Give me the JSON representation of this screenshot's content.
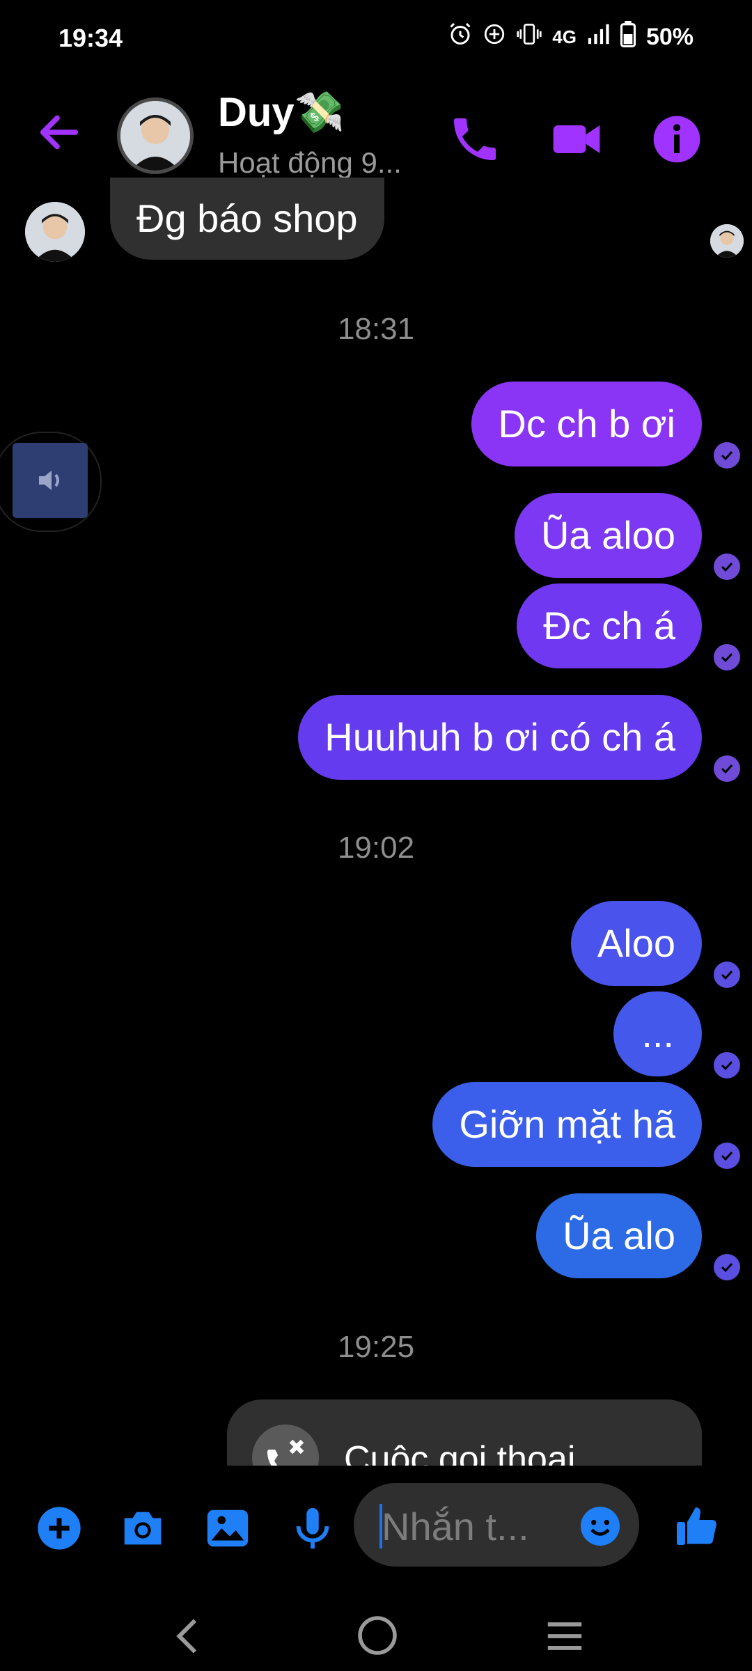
{
  "status_bar": {
    "time": "19:34",
    "network": "4G",
    "battery": "50%"
  },
  "header": {
    "contact_name": "Duy💸",
    "contact_status": "Hoạt động 9..."
  },
  "messages": {
    "incoming_1": "Đg báo shop",
    "time_1": "18:31",
    "out_1": "Dc ch b ơi",
    "out_2": "Ũa aloo",
    "out_3": "Đc ch á",
    "out_4": "Huuhuh b ơi có ch á",
    "time_2": "19:02",
    "out_5": "Aloo",
    "out_6": "...",
    "out_7": "Giỡn mặt hã",
    "out_8": "Ũa alo",
    "time_3": "19:25",
    "call_card": "Cuộc gọi thoại"
  },
  "composer": {
    "placeholder": "Nhắn t..."
  },
  "colors": {
    "accent": "#a033ff",
    "bubble_purple_1": "#8a35f5",
    "bubble_purple_2": "#6f3bf0",
    "bubble_blue_1": "#4755ec",
    "bubble_blue_2": "#2d6be6",
    "composer_icon": "#1e7ff6"
  },
  "icons": [
    "arrow-left-icon",
    "phone-icon",
    "video-icon",
    "info-icon",
    "plus-icon",
    "camera-icon",
    "image-icon",
    "microphone-icon",
    "emoji-icon",
    "thumbs-up-icon",
    "speaker-icon",
    "missed-call-icon"
  ]
}
